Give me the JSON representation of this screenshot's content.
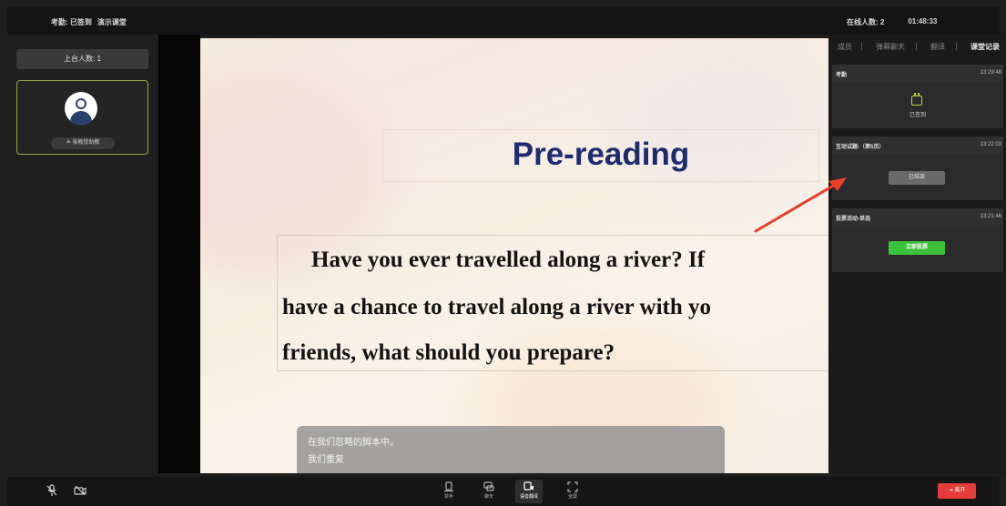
{
  "header": {
    "attendance": "考勤: 已签到",
    "classroom": "演示课堂",
    "online_count": "在线人数: 2",
    "timer": "01:48:33"
  },
  "left_panel": {
    "stage_count": "上台人数: 1",
    "assistant_label": "≗ 张教授助教"
  },
  "slide": {
    "title": "Pre-reading",
    "question_lines": [
      "Have you ever travelled along a river? If",
      "have a chance to travel along a river with yo",
      "friends, what should you prepare?"
    ]
  },
  "subtitles": {
    "line1": "在我们忽略的脚本中。",
    "line2": "我们重复"
  },
  "right_panel": {
    "tabs": [
      "成员",
      "弹幕聊天",
      "翻译",
      "课堂记录"
    ],
    "active_tab": "课堂记录",
    "records": [
      {
        "title": "考勤",
        "time": "13:29:48",
        "status": "已签到"
      },
      {
        "title": "互动试题-（第5页）",
        "time": "13:22:03",
        "button": "已结束"
      },
      {
        "title": "投票活动-单选",
        "time": "13:21:46",
        "button": "立即投票"
      }
    ]
  },
  "bottom_bar": {
    "tools": [
      "举手",
      "聊天",
      "语音翻译",
      "全屏"
    ],
    "leave": "离开"
  },
  "colors": {
    "accent_green": "#3cc13c",
    "leave_red": "#e63b3b",
    "arrow_red": "#e8402c",
    "title_blue": "#1f2b6e",
    "stage_border": "#9aa24a"
  }
}
